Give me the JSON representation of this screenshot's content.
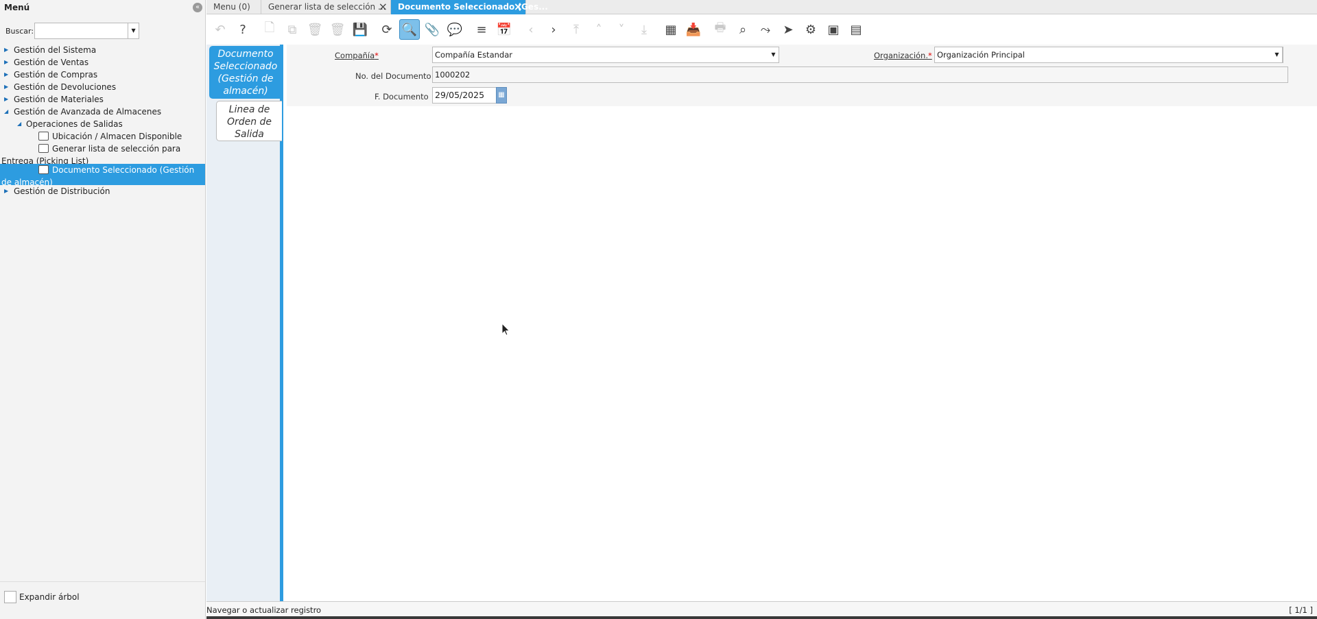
{
  "menu": {
    "title": "Menú",
    "collapse_icon": "«",
    "search_label": "Buscar:",
    "search_value": "",
    "tree": [
      {
        "label": "Gestión del Sistema",
        "level": 0,
        "expanded": false
      },
      {
        "label": "Gestión de Ventas",
        "level": 0,
        "expanded": false
      },
      {
        "label": "Gestión de Compras",
        "level": 0,
        "expanded": false
      },
      {
        "label": "Gestión de Devoluciones",
        "level": 0,
        "expanded": false
      },
      {
        "label": "Gestión de Materiales",
        "level": 0,
        "expanded": false
      },
      {
        "label": "Gestión de Avanzada de Almacenes",
        "level": 0,
        "expanded": true
      },
      {
        "label": "Operaciones de Salidas",
        "level": 1,
        "expanded": true
      },
      {
        "label": "Ubicación / Almacen Disponible",
        "level": 2,
        "icon": "info-window-icon"
      },
      {
        "label": "Generar lista de selección para Entrega (Picking List)",
        "level": 2,
        "icon": "process-gear-icon"
      },
      {
        "label": "Documento Seleccionado (Gestión de almacén)",
        "level": 2,
        "icon": "window-icon",
        "selected": true
      },
      {
        "label": "Gestión de Distribución",
        "level": 0,
        "expanded": false
      }
    ],
    "expand_tree_label": "Expandir árbol"
  },
  "tabs": [
    {
      "label": "Menu (0)",
      "closable": false,
      "active": false
    },
    {
      "label": "Generar lista de selección ...",
      "closable": true,
      "active": false
    },
    {
      "label": "Documento Seleccionado (Ges...",
      "closable": true,
      "active": true
    }
  ],
  "toolbar": {
    "buttons": [
      {
        "name": "undo-icon",
        "glyph": "↶",
        "enabled": false
      },
      {
        "name": "help-icon",
        "glyph": "?",
        "enabled": true
      },
      {
        "name": "new-record-icon",
        "glyph": "🗋",
        "enabled": false
      },
      {
        "name": "copy-record-icon",
        "glyph": "⧉",
        "enabled": false
      },
      {
        "name": "delete-icon",
        "glyph": "🗑",
        "enabled": false
      },
      {
        "name": "delete-selection-icon",
        "glyph": "🗑",
        "enabled": false
      },
      {
        "name": "save-icon",
        "glyph": "💾",
        "enabled": false
      },
      {
        "name": "refresh-icon",
        "glyph": "⟳",
        "enabled": true
      },
      {
        "name": "find-icon",
        "glyph": "🔍",
        "enabled": true,
        "pressed": true
      },
      {
        "name": "attachment-icon",
        "glyph": "📎",
        "enabled": true
      },
      {
        "name": "chat-icon",
        "glyph": "💬",
        "enabled": true
      },
      {
        "name": "grid-toggle-icon",
        "glyph": "≡",
        "enabled": true
      },
      {
        "name": "calendar-icon",
        "glyph": "📅",
        "enabled": false
      },
      {
        "name": "previous-record-icon",
        "glyph": "‹",
        "enabled": false
      },
      {
        "name": "next-record-icon",
        "glyph": "›",
        "enabled": true
      },
      {
        "name": "first-record-icon",
        "glyph": "⤒",
        "enabled": false
      },
      {
        "name": "parent-record-icon",
        "glyph": "˄",
        "enabled": false
      },
      {
        "name": "detail-record-icon",
        "glyph": "˅",
        "enabled": false
      },
      {
        "name": "last-record-icon",
        "glyph": "⤓",
        "enabled": false
      },
      {
        "name": "report-icon",
        "glyph": "▦",
        "enabled": true
      },
      {
        "name": "archive-icon",
        "glyph": "📥",
        "enabled": true
      },
      {
        "name": "print-icon",
        "glyph": "🖶",
        "enabled": false
      },
      {
        "name": "zoom-across-icon",
        "glyph": "⌕",
        "enabled": true
      },
      {
        "name": "workflow-icon",
        "glyph": "⤳",
        "enabled": true
      },
      {
        "name": "send-icon",
        "glyph": "➤",
        "enabled": true
      },
      {
        "name": "process-icon",
        "glyph": "⚙",
        "enabled": true
      },
      {
        "name": "product-info-icon",
        "glyph": "▣",
        "enabled": true
      },
      {
        "name": "customize-icon",
        "glyph": "▤",
        "enabled": true
      }
    ]
  },
  "detail_tabs": {
    "active": "Documento Seleccionado (Gestión de almacén)",
    "child": "Linea de Orden de Salida"
  },
  "form": {
    "company_label": "Compañía",
    "company_value": "Compañía Estandar",
    "org_label": "Organización.",
    "org_value": "Organización Principal",
    "docno_label": "No. del Documento",
    "docno_value": "1000202",
    "date_label": "F. Documento",
    "date_value": "29/05/2025",
    "required_mark": "*"
  },
  "status": {
    "message": "Navegar o actualizar registro",
    "record_count": "[ 1/1 ]"
  },
  "colors": {
    "accent": "#2d9ce0",
    "required": "#dd0000"
  }
}
